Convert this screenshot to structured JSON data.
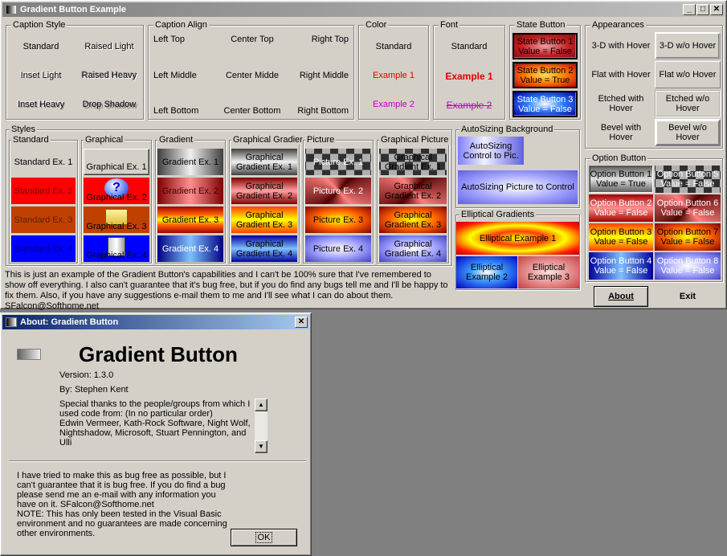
{
  "main_window": {
    "title": "Gradient Button Example",
    "caption_style": {
      "legend": "Caption Style",
      "items": [
        "Standard",
        "Raised Light",
        "Inset Light",
        "Raised Heavy",
        "Inset Heavy",
        "Drop Shadow"
      ]
    },
    "caption_align": {
      "legend": "Caption Align",
      "items": [
        "Left Top",
        "Center Top",
        "Right Top",
        "Left Middle",
        "Center Midde",
        "Right Middle",
        "Left Bottom",
        "Center Bottom",
        "Right Bottom"
      ]
    },
    "color": {
      "legend": "Color",
      "items": [
        "Standard",
        "Example 1",
        "Example 2"
      ]
    },
    "font": {
      "legend": "Font",
      "items": [
        "Standard",
        "Example 1",
        "Example 2"
      ]
    },
    "state_button": {
      "legend": "State Button",
      "items": [
        "State Button 1\nValue = False",
        "State Button 2\nValue = True",
        "State Button 3\nValue = False"
      ]
    },
    "appearances": {
      "legend": "Appearances",
      "items": [
        "3-D with Hover",
        "3-D w/o Hover",
        "Flat with Hover",
        "Flat w/o Hover",
        "Etched with\nHover",
        "Etched w/o\nHover",
        "Bevel with\nHover",
        "Bevel w/o\nHover"
      ]
    },
    "styles": {
      "legend": "Styles",
      "standard": {
        "legend": "Standard",
        "items": [
          "Standard Ex. 1",
          "Standard Ex. 2",
          "Standard Ex. 3",
          "Standard Ex. 4"
        ]
      },
      "graphical": {
        "legend": "Graphical",
        "items": [
          "Graphical Ex. 1",
          "Graphical Ex. 2",
          "Graphical Ex. 3",
          "Graphical Ex. 4"
        ]
      },
      "gradient": {
        "legend": "Gradient",
        "items": [
          "Gradient Ex. 1",
          "Gradient Ex. 2",
          "Gradient Ex. 3",
          "Gradient Ex. 4"
        ]
      },
      "graphical_gradient": {
        "legend": "Graphical Gradier",
        "items": [
          "Graphical\nGradient Ex. 1",
          "Graphical\nGradient Ex. 2",
          "Graphical\nGradient Ex. 3",
          "Graphical\nGradient Ex. 4"
        ]
      },
      "picture": {
        "legend": "Picture",
        "items": [
          "Picture Ex. 1",
          "Picture Ex. 2",
          "Picture Ex. 3",
          "Picture Ex. 4"
        ]
      },
      "graphical_picture": {
        "legend": "Graphical Picture",
        "items": [
          "Graphical\nGradient Ex. 1",
          "Graphical\nGradient Ex. 2",
          "Graphical\nGradient Ex. 3",
          "Graphical\nGradient Ex. 4"
        ]
      }
    },
    "autosizing": {
      "legend": "AutoSizing Background",
      "items": [
        "AutoSizing\nControl to Pic.",
        "AutoSizing Picture to Control"
      ]
    },
    "elliptical": {
      "legend": "Elliptical Gradients",
      "items": [
        "Elliptical Example 1",
        "Elliptical\nExample 2",
        "Elliptical\nExample 3"
      ]
    },
    "option_button": {
      "legend": "Option Button",
      "items": [
        "Option Button 1\nValue = True",
        "Option Button 5\nValue = False",
        "Option Button 2\nValue = False",
        "Option Button 6\nValue = False",
        "Option Button 3\nValue = False",
        "Option Button 7\nValue = False",
        "Option Button 4\nValue = False",
        "Option Button 8\nValue = False"
      ]
    },
    "description": "This is just an example of the Gradient Button's capabilities and I can't be 100% sure that I've remembered to show off everything.  I also can't guarantee that it's bug free, but if you do find any bugs tell me and I'll be happy to fix them. Also, if you have any suggestions e-mail them to me and I'll see what I can do about them.  SFalcon@Softhome.net",
    "about_button": "About",
    "exit_button": "Exit"
  },
  "about_dialog": {
    "title": "About: Gradient Button",
    "app_name": "Gradient Button",
    "version": "Version: 1.3.0",
    "author": "By: Stephen Kent",
    "thanks": "Special thanks to the people/groups from which I used code from: (In no particular order)\nEdwin Vermeer, Kath-Rock Software, Night Wolf, Nightshadow, Microsoft, Stuart Pennington, and Ulli",
    "disclaimer": "I have tried to make this as bug free as possible, but I can't guarantee that it is bug free.  If you do find a bug please send me an e-mail with any information you have on it.  SFalcon@Softhome.net\nNOTE: This has only been tested in the Visual Basic environment and no guarantees are made concerning other environments.",
    "ok_button": "OK"
  }
}
